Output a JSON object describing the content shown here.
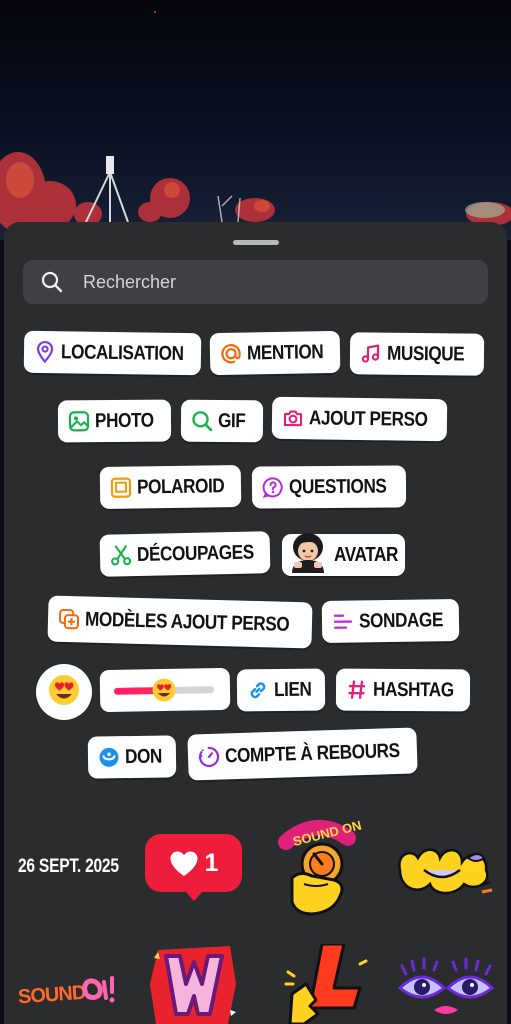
{
  "search": {
    "placeholder": "Rechercher"
  },
  "stickers": {
    "localisation": "LOCALISATION",
    "mention": "MENTION",
    "musique": "MUSIQUE",
    "photo": "PHOTO",
    "gif": "GIF",
    "ajout_perso": "AJOUT PERSO",
    "polaroid": "POLAROID",
    "questions": "QUESTIONS",
    "decoupages": "DÉCOUPAGES",
    "avatar": "AVATAR",
    "modeles_ajout_perso": "MODÈLES AJOUT PERSO",
    "sondage": "SONDAGE",
    "lien": "LIEN",
    "hashtag": "HASHTAG",
    "don": "DON",
    "compte_a_rebours": "COMPTE À REBOURS"
  },
  "emoji_slider": {
    "emoji": "😍",
    "level": 0.5
  },
  "date_sticker": "26 SEPT. 2025",
  "like_sticker": {
    "count": "1"
  },
  "icons": {
    "search": "search-icon",
    "localisation": "location-pin-icon",
    "mention": "threads-at-icon",
    "musique": "music-note-icon",
    "photo": "image-icon",
    "gif": "search-gif-icon",
    "ajout_perso": "camera-icon",
    "polaroid": "polaroid-icon",
    "questions": "question-bubble-icon",
    "decoupages": "scissors-icon",
    "modeles": "template-plus-icon",
    "sondage": "poll-lines-icon",
    "lien": "link-icon",
    "hashtag": "hashtag-icon",
    "don": "donation-icon",
    "compte": "countdown-timer-icon",
    "like": "heart-icon"
  },
  "colors": {
    "sheet": "#2b2c2e",
    "search_bg": "#3f4044",
    "location": "#7c3aed",
    "mention": "#f56a0a",
    "music": "#e0217c",
    "photo": "#19b34a",
    "gif": "#19b34a",
    "camera": "#e0217c",
    "polaroid": "#f59a0a",
    "questions": "#b62bd8",
    "scissors": "#19b34a",
    "poll": "#c42ad6",
    "link": "#1d8ff0",
    "hashtag": "#e0217c",
    "don": "#1d8ff0",
    "countdown": "#9b2ae0",
    "like": "#ee1d3c"
  }
}
